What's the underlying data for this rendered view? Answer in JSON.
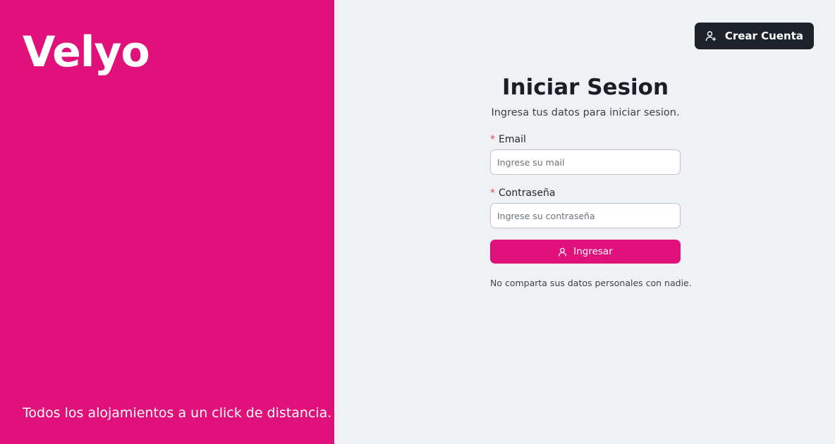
{
  "brand": {
    "logo_text": "Velyo",
    "tagline": "Todos los alojamientos a un click de distancia.",
    "color": "#E0117A"
  },
  "header": {
    "create_account_label": "Crear Cuenta",
    "create_account_icon": "user-plus-icon"
  },
  "login_form": {
    "title": "Iniciar Sesion",
    "subtitle": "Ingresa tus datos para iniciar sesion.",
    "required_marker": "*",
    "email": {
      "label": "Email",
      "placeholder": "Ingrese su mail",
      "value": ""
    },
    "password": {
      "label": "Contraseña",
      "placeholder": "Ingrese su contraseña",
      "value": ""
    },
    "submit_label": "Ingresar",
    "submit_icon": "user-icon",
    "privacy_note": "No comparta sus datos personales con nadie."
  }
}
